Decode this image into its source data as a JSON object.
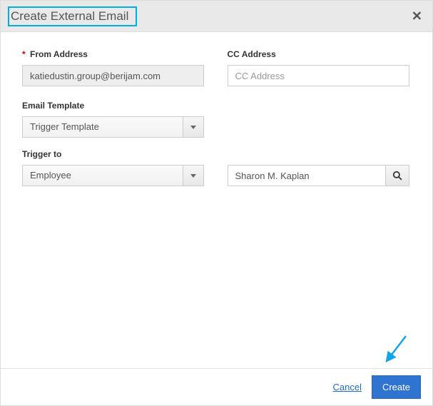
{
  "dialog": {
    "title": "Create External Email"
  },
  "form": {
    "from": {
      "label": "From Address",
      "value": "katiedustin.group@berijam.com",
      "required": true
    },
    "cc": {
      "label": "CC Address",
      "placeholder": "CC Address",
      "value": ""
    },
    "template": {
      "label": "Email Template",
      "selected": "Trigger Template"
    },
    "trigger_to": {
      "label": "Trigger to",
      "selected": "Employee",
      "lookup_value": "Sharon M. Kaplan"
    }
  },
  "footer": {
    "cancel": "Cancel",
    "create": "Create"
  },
  "icons": {
    "close": "✕",
    "search": "search-icon",
    "dropdown": "chevron-down-icon"
  }
}
